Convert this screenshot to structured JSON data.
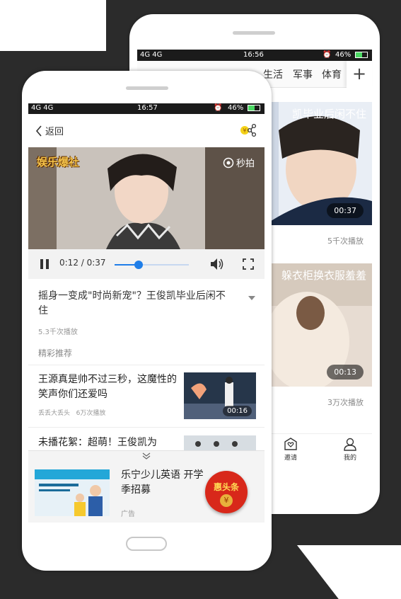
{
  "back_phone": {
    "status": {
      "signal": "4G 4G",
      "time": "16:56",
      "battery": "46%"
    },
    "tabs": [
      "生活",
      "军事",
      "体育"
    ],
    "add_tab": "+",
    "cards": [
      {
        "title": "凯毕业后闲不住",
        "duration": "00:37",
        "plays": "5千次播放"
      },
      {
        "title": "躲衣柜换衣服羞羞",
        "duration": "00:13",
        "plays": "3万次播放"
      }
    ],
    "nav": [
      {
        "label": "邀请",
        "icon": "envelope-heart-icon"
      },
      {
        "label": "我的",
        "icon": "user-icon"
      }
    ]
  },
  "front_phone": {
    "status": {
      "signal": "4G 4G",
      "time": "16:57",
      "battery": "46%"
    },
    "header": {
      "back_label": "返回",
      "share_icon": "share-icon"
    },
    "video": {
      "logo": "娱乐爆社",
      "watermark": "秒拍"
    },
    "player": {
      "current_time": "0:12",
      "total_time": "0:37",
      "time_display": "0:12 / 0:37",
      "progress": 0.32
    },
    "article": {
      "title": "摇身一变成\"时尚新宠\"？王俊凯毕业后闲不住",
      "plays": "5.3千次播放"
    },
    "section_label": "精彩推荐",
    "recommendations": [
      {
        "title": "王源真是帅不过三秒，这魔性的笑声你们还爱吗",
        "source": "丢丢大丢头",
        "plays": "6万次播放",
        "duration": "00:16"
      },
      {
        "title": "未播花絮：超萌！王俊凯为",
        "source": "",
        "plays": "",
        "duration": ""
      }
    ],
    "ad": {
      "title": "乐宁少儿英语 开学季招募",
      "label": "广告",
      "badge": "惠头条",
      "badge_coin": "¥"
    }
  },
  "colors": {
    "accent": "#1f7ee8",
    "badge": "#d8281a",
    "background": "#2b2b2b"
  }
}
